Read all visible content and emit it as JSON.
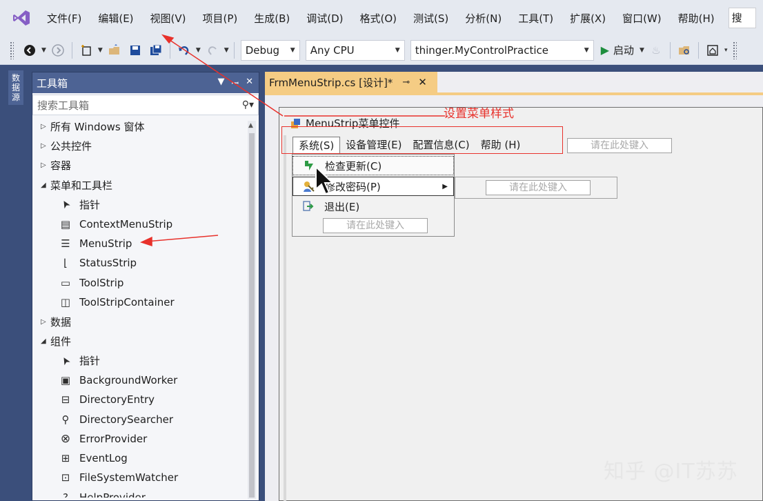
{
  "menu": {
    "items": [
      "文件(F)",
      "编辑(E)",
      "视图(V)",
      "项目(P)",
      "生成(B)",
      "调试(D)",
      "格式(O)",
      "测试(S)",
      "分析(N)",
      "工具(T)",
      "扩展(X)",
      "窗口(W)",
      "帮助(H)"
    ],
    "search_label": "搜"
  },
  "toolbar": {
    "config": "Debug",
    "platform": "Any CPU",
    "project": "thinger.MyControlPractice",
    "start_label": "启动"
  },
  "left_strip": {
    "tab_label": "数据源"
  },
  "toolbox": {
    "title": "工具箱",
    "search_placeholder": "搜索工具箱",
    "rows": [
      {
        "type": "cat",
        "expanded": false,
        "label": "所有 Windows 窗体"
      },
      {
        "type": "cat",
        "expanded": false,
        "label": "公共控件"
      },
      {
        "type": "cat",
        "expanded": false,
        "label": "容器"
      },
      {
        "type": "cat",
        "expanded": true,
        "label": "菜单和工具栏"
      },
      {
        "type": "item",
        "icon": "pointer-icon",
        "label": "指针"
      },
      {
        "type": "item",
        "icon": "context-menu-strip-icon",
        "label": "ContextMenuStrip"
      },
      {
        "type": "item",
        "icon": "menu-strip-icon",
        "label": "MenuStrip"
      },
      {
        "type": "item",
        "icon": "status-strip-icon",
        "label": "StatusStrip"
      },
      {
        "type": "item",
        "icon": "tool-strip-icon",
        "label": "ToolStrip"
      },
      {
        "type": "item",
        "icon": "tool-strip-container-icon",
        "label": "ToolStripContainer"
      },
      {
        "type": "cat",
        "expanded": false,
        "label": "数据"
      },
      {
        "type": "cat",
        "expanded": true,
        "label": "组件"
      },
      {
        "type": "item",
        "icon": "pointer-icon",
        "label": "指针"
      },
      {
        "type": "item",
        "icon": "background-worker-icon",
        "label": "BackgroundWorker"
      },
      {
        "type": "item",
        "icon": "directory-entry-icon",
        "label": "DirectoryEntry"
      },
      {
        "type": "item",
        "icon": "directory-searcher-icon",
        "label": "DirectorySearcher"
      },
      {
        "type": "item",
        "icon": "error-provider-icon",
        "label": "ErrorProvider"
      },
      {
        "type": "item",
        "icon": "event-log-icon",
        "label": "EventLog"
      },
      {
        "type": "item",
        "icon": "file-system-watcher-icon",
        "label": "FileSystemWatcher"
      },
      {
        "type": "item",
        "icon": "help-provider-icon",
        "label": "HelpProvider"
      }
    ]
  },
  "document": {
    "tab_label": "FrmMenuStrip.cs [设计]*"
  },
  "form": {
    "title": "MenuStrip菜单控件",
    "menu_items": [
      "系统(S)",
      "设备管理(E)",
      "配置信息(C)",
      "帮助 (H)"
    ],
    "type_here": "请在此处键入",
    "dropdown": [
      {
        "label": "检查更新(C)",
        "icon": "update-icon"
      },
      {
        "label": "修改密码(P)",
        "icon": "key-user-icon",
        "submenu": true
      },
      {
        "label": "退出(E)",
        "icon": "exit-icon"
      }
    ]
  },
  "annotation": {
    "text": "设置菜单样式"
  },
  "watermark": {
    "text": "知乎 @IT苏苏"
  },
  "colors": {
    "accent_red": "#e8312b",
    "tab_active": "#f5cc84",
    "toolbox_header": "#4d6394",
    "vs_purple": "#865fc5"
  }
}
